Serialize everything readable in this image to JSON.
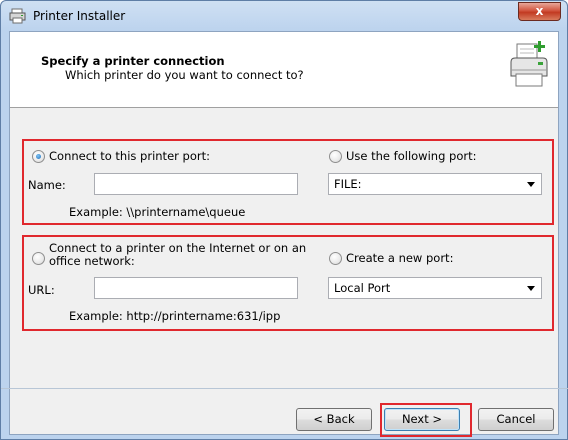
{
  "window": {
    "title": "Printer Installer",
    "close_label": "x"
  },
  "header": {
    "title": "Specify a printer connection",
    "subtitle": "Which printer do you want to connect to?"
  },
  "local_group": {
    "radio_label": "Connect to this printer port:",
    "radio_checked": true,
    "name_label": "Name:",
    "name_value": "",
    "example": "Example: \\\\printername\\queue",
    "port_radio_label": "Use the following port:",
    "port_radio_checked": false,
    "port_value": "FILE:"
  },
  "network_group": {
    "radio_label_line1": "Connect to a printer on the Internet or on an",
    "radio_label_line2": "office network:",
    "radio_checked": false,
    "url_label": "URL:",
    "url_value": "",
    "example": "Example: http://printername:631/ipp",
    "new_port_radio_label": "Create a new port:",
    "new_port_radio_checked": false,
    "new_port_value": "Local Port"
  },
  "buttons": {
    "back": "< Back",
    "next": "Next >",
    "cancel": "Cancel"
  },
  "colors": {
    "highlight_border": "#e0282e",
    "client_bg": "#f0f0f0",
    "titlebar_bg": "#cfe0f3"
  }
}
